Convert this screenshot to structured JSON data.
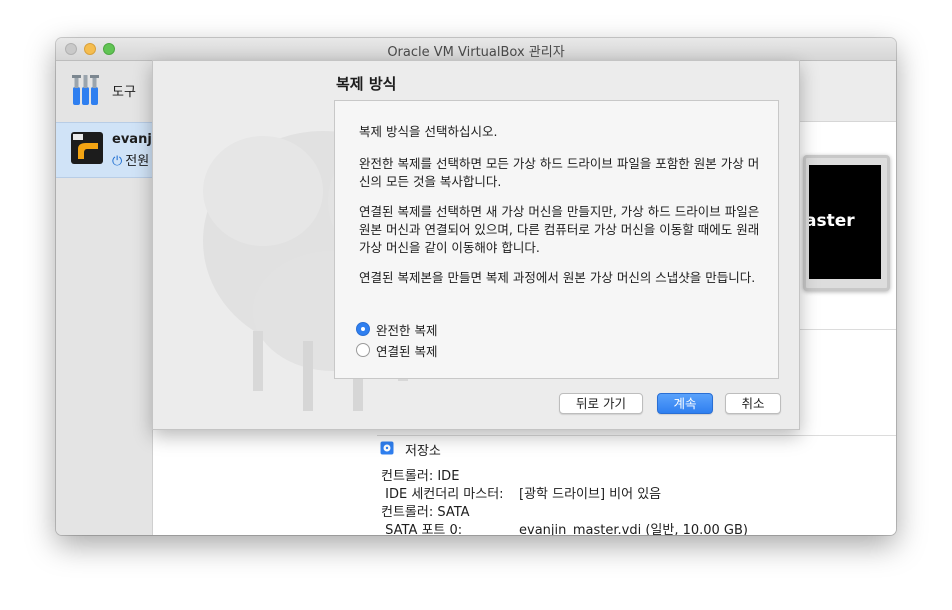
{
  "window": {
    "title": "Oracle VM VirtualBox 관리자"
  },
  "sidebar": {
    "tools_label": "도구",
    "vm": {
      "name": "evanjin_master",
      "state": "전원 꺼짐"
    }
  },
  "preview": {
    "text": "aster"
  },
  "details": {
    "storage": {
      "title": "저장소",
      "rows": [
        {
          "label": "컨트롤러: IDE",
          "value": ""
        },
        {
          "label": " IDE 세컨더리 마스터:",
          "value": "[광학 드라이브] 비어 있음"
        },
        {
          "label": "컨트롤러: SATA",
          "value": ""
        },
        {
          "label": " SATA 포트 0:",
          "value": "evanjin_master.vdi (일반, 10.00 GB)"
        }
      ]
    }
  },
  "dialog": {
    "title": "복제 방식",
    "paragraphs": [
      "복제 방식을 선택하십시오.",
      "완전한 복제를 선택하면 모든 가상 하드 드라이브 파일을 포함한 원본 가상 머신의 모든 것을 복사합니다.",
      "연결된 복제를 선택하면 새 가상 머신을 만들지만, 가상 하드 드라이브 파일은 원본 머신과 연결되어 있으며, 다른 컴퓨터로 가상 머신을 이동할 때에도 원래 가상 머신을 같이 이동해야 합니다.",
      "연결된 복제본을 만들면 복제 과정에서 원본 가상 머신의 스냅샷을 만듭니다."
    ],
    "options": [
      {
        "label": "완전한 복제",
        "selected": true
      },
      {
        "label": "연결된 복제",
        "selected": false
      }
    ],
    "buttons": {
      "back": "뒤로 가기",
      "continue": "계속",
      "cancel": "취소"
    }
  },
  "colors": {
    "accent": "#2f7ff0",
    "selection": "#d0e3f7"
  },
  "icons": [
    "tools-icon",
    "vm-os-icon",
    "power-off-icon",
    "storage-icon",
    "sheep-watermark"
  ]
}
